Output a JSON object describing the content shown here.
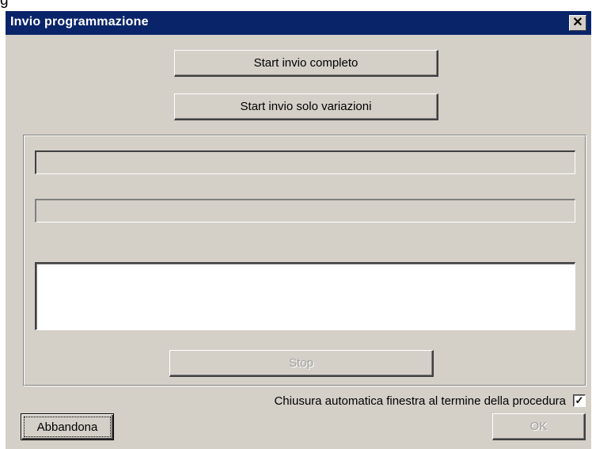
{
  "window": {
    "title": "Invio programmazione",
    "close_glyph": "✕"
  },
  "buttons": {
    "start_full": "Start invio completo",
    "start_changes": "Start invio solo variazioni",
    "stop": "Stop",
    "abandon": "Abbandona",
    "ok": "OK"
  },
  "progress": {
    "primary_fraction": 0.0,
    "secondary_fraction": 0.0
  },
  "log": {
    "content": ""
  },
  "options": {
    "auto_close_label": "Chiusura automatica finestra al termine della procedura",
    "auto_close_checked": true,
    "check_glyph": "✓"
  },
  "colors": {
    "titlebar": "#0a246a",
    "face": "#d4d0c8"
  }
}
